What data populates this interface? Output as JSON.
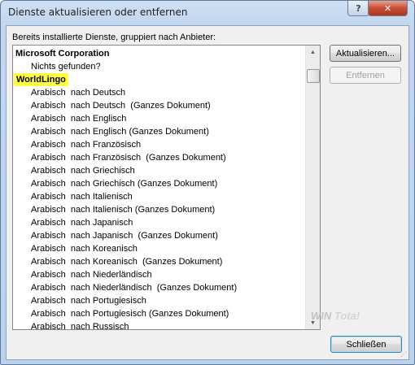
{
  "window": {
    "title": "Dienste aktualisieren oder entfernen",
    "help_label": "?",
    "close_label": "✕"
  },
  "list": {
    "label": "Bereits installierte Dienste, gruppiert nach Anbieter:",
    "groups": [
      {
        "name": "Microsoft Corporation",
        "highlighted": false,
        "items": [
          "Nichts gefunden?"
        ]
      },
      {
        "name": "WorldLingo",
        "highlighted": true,
        "items": [
          "Arabisch  nach Deutsch",
          "Arabisch  nach Deutsch  (Ganzes Dokument)",
          "Arabisch  nach Englisch",
          "Arabisch  nach Englisch (Ganzes Dokument)",
          "Arabisch  nach Französisch",
          "Arabisch  nach Französisch  (Ganzes Dokument)",
          "Arabisch  nach Griechisch",
          "Arabisch  nach Griechisch (Ganzes Dokument)",
          "Arabisch  nach Italienisch",
          "Arabisch  nach Italienisch (Ganzes Dokument)",
          "Arabisch  nach Japanisch",
          "Arabisch  nach Japanisch  (Ganzes Dokument)",
          "Arabisch  nach Koreanisch",
          "Arabisch  nach Koreanisch  (Ganzes Dokument)",
          "Arabisch  nach Niederländisch",
          "Arabisch  nach Niederländisch  (Ganzes Dokument)",
          "Arabisch  nach Portugiesisch",
          "Arabisch  nach Portugiesisch (Ganzes Dokument)",
          "Arabisch  nach Russisch"
        ]
      }
    ],
    "highlight_color": "#ffff3c"
  },
  "buttons": {
    "refresh": "Aktualisieren...",
    "remove": "Entfernen",
    "close": "Schließen"
  },
  "watermark": {
    "part1": "WIN",
    "part2": "Tota!"
  }
}
